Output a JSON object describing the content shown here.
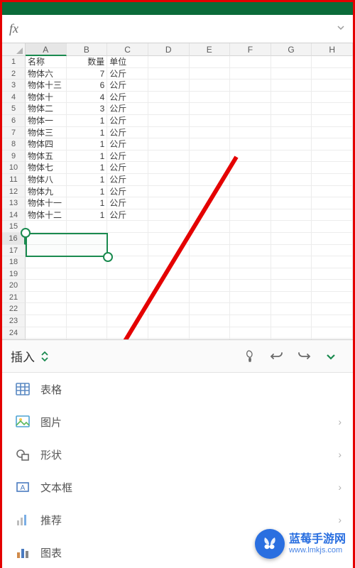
{
  "formula_bar": {
    "fx_symbol": "fx"
  },
  "columns": [
    "A",
    "B",
    "C",
    "D",
    "E",
    "F",
    "G",
    "H"
  ],
  "selected_column_index": 0,
  "rows_count": 26,
  "selected_row_index": 15,
  "selection": {
    "row_start": 15,
    "row_end": 16,
    "col_start": 0,
    "col_end": 1
  },
  "headers": {
    "A": "名称",
    "B": "数量",
    "C": "单位"
  },
  "data_rows": [
    {
      "A": "物体六",
      "B": 7,
      "C": "公斤"
    },
    {
      "A": "物体十三",
      "B": 6,
      "C": "公斤"
    },
    {
      "A": "物体十",
      "B": 4,
      "C": "公斤"
    },
    {
      "A": "物体二",
      "B": 3,
      "C": "公斤"
    },
    {
      "A": "物体一",
      "B": 1,
      "C": "公斤"
    },
    {
      "A": "物体三",
      "B": 1,
      "C": "公斤"
    },
    {
      "A": "物体四",
      "B": 1,
      "C": "公斤"
    },
    {
      "A": "物体五",
      "B": 1,
      "C": "公斤"
    },
    {
      "A": "物体七",
      "B": 1,
      "C": "公斤"
    },
    {
      "A": "物体八",
      "B": 1,
      "C": "公斤"
    },
    {
      "A": "物体九",
      "B": 1,
      "C": "公斤"
    },
    {
      "A": "物体十一",
      "B": 1,
      "C": "公斤"
    },
    {
      "A": "物体十二",
      "B": 1,
      "C": "公斤"
    }
  ],
  "toolbar": {
    "mode_label": "插入",
    "lightbulb_icon": "lightbulb",
    "undo_icon": "undo",
    "redo_icon": "redo",
    "more_icon": "chevron-down"
  },
  "menu": {
    "items": [
      {
        "key": "table",
        "label": "表格",
        "icon": "table-icon",
        "has_chevron": false
      },
      {
        "key": "picture",
        "label": "图片",
        "icon": "picture-icon",
        "has_chevron": true
      },
      {
        "key": "shapes",
        "label": "形状",
        "icon": "shapes-icon",
        "has_chevron": true
      },
      {
        "key": "textbox",
        "label": "文本框",
        "icon": "textbox-icon",
        "has_chevron": true
      },
      {
        "key": "recommend",
        "label": "推荐",
        "icon": "recommend-icon",
        "has_chevron": true
      },
      {
        "key": "chart",
        "label": "图表",
        "icon": "chart-icon",
        "has_chevron": false
      }
    ]
  },
  "annotation": {
    "arrow_target": "picture"
  },
  "watermark": {
    "line1": "蓝莓手游网",
    "line2": "www.lmkjs.com"
  },
  "colors": {
    "accent_green": "#1a8a4f",
    "frame_red": "#e40000",
    "badge_blue": "#2a6fe0"
  }
}
